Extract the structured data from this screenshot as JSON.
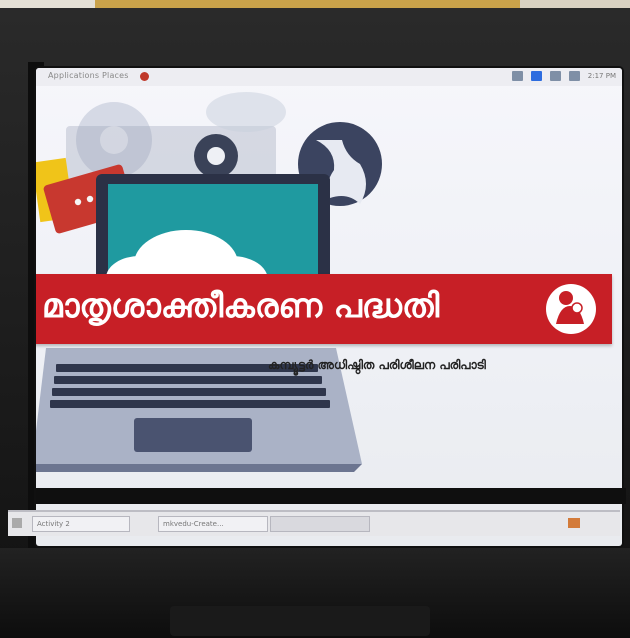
{
  "menubar": {
    "text": "Applications  Places",
    "clock": "2:17 PM"
  },
  "slide": {
    "title": "മാതൃശാക്തീകരണ പദ്ധതി",
    "subtitle": "കമ്പ്യൂട്ടർ അധിഷ്ഠിത പരിശീലന പരിപാടി"
  },
  "taskbar": {
    "items": [
      "Activity 2",
      "mkvedu-Create...",
      ""
    ]
  },
  "colors": {
    "band": "#c71f26",
    "screen_bg": "#f1f2f7",
    "laptop_screen": "#1f9aa0"
  }
}
